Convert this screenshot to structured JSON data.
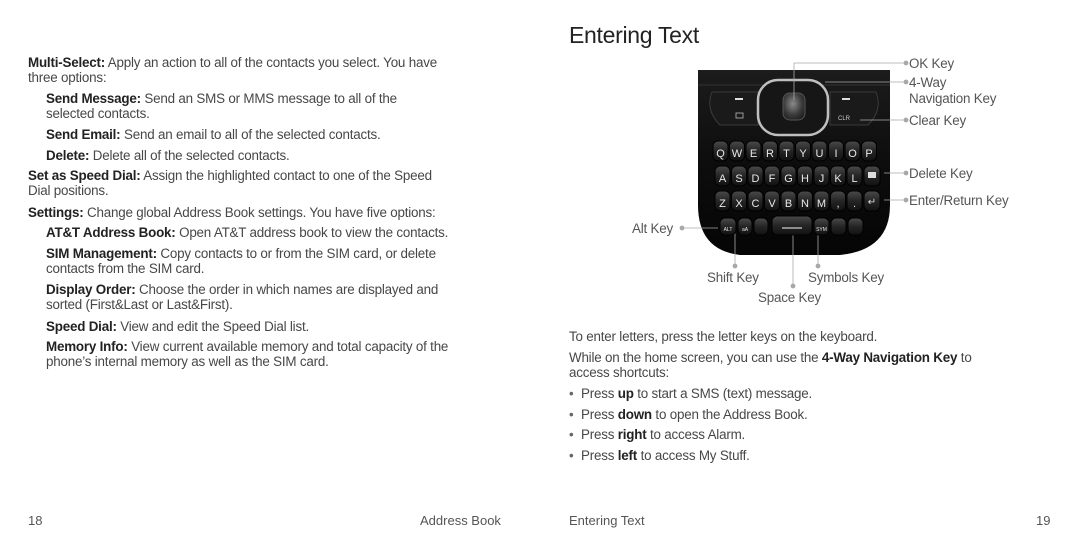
{
  "left_page": {
    "page_number": "18",
    "section_title": "Address Book",
    "entries": [
      {
        "label": "Multi-Select:",
        "text": " Apply an action to all of the contacts you select. You have",
        "text2": "three options:",
        "level": 0
      },
      {
        "label": "Send Message:",
        "text": " Send an SMS or MMS message to all of the",
        "text2": "selected contacts.",
        "level": 1
      },
      {
        "label": "Send Email:",
        "text": " Send an email to all of the selected contacts.",
        "text2": "",
        "level": 1
      },
      {
        "label": "Delete:",
        "text": " Delete all of the selected contacts.",
        "text2": "",
        "level": 1
      },
      {
        "label": "Set as Speed Dial:",
        "text": " Assign the highlighted contact to one of the Speed",
        "text2": "Dial positions.",
        "level": 0
      },
      {
        "label": "Settings:",
        "text": " Change global Address Book settings. You have five options:",
        "text2": "",
        "level": 0
      },
      {
        "label": "AT&T Address Book:",
        "text": " Open AT&T address book to view the contacts.",
        "text2": "",
        "level": 1
      },
      {
        "label": "SIM Management:",
        "text": " Copy contacts to or from the SIM card, or delete",
        "text2": "contacts from the SIM card.",
        "level": 1
      },
      {
        "label": "Display Order:",
        "text": " Choose the order in which names are displayed and",
        "text2": "sorted (First&Last or Last&First).",
        "level": 1
      },
      {
        "label": "Speed Dial:",
        "text": " View and edit the Speed Dial list.",
        "text2": "",
        "level": 1
      },
      {
        "label": "Memory Info:",
        "text": " View current available memory and total capacity of the",
        "text2": "phone’s internal memory as well as the SIM card.",
        "level": 1
      }
    ]
  },
  "right_page": {
    "page_number": "19",
    "section_title": "Entering Text",
    "heading": "Entering Text",
    "callouts": {
      "ok_key": "OK Key",
      "nav_key_line1": "4-Way",
      "nav_key_line2": "Navigation Key",
      "clear_key": "Clear Key",
      "delete_key": "Delete Key",
      "enter_key": "Enter/Return Key",
      "alt_key": "Alt Key",
      "shift_key": "Shift Key",
      "symbols_key": "Symbols Key",
      "space_key": "Space Key"
    },
    "keyboard": {
      "row1": [
        "Q",
        "W",
        "E",
        "R",
        "T",
        "Y",
        "U",
        "I",
        "O",
        "P"
      ],
      "row2": [
        "A",
        "S",
        "D",
        "F",
        "G",
        "H",
        "J",
        "K",
        "L"
      ],
      "row3": [
        "Z",
        "X",
        "C",
        "V",
        "B",
        "N",
        "M",
        ",",
        "."
      ],
      "clr_label": "CLR",
      "alt_label": "ALT",
      "shift_label": "aA",
      "sym_label": "SYM"
    },
    "intro": "To enter letters, press the letter keys on the keyboard.",
    "nav_para_pre": "While on the home screen, you can use the ",
    "nav_para_bold": "4-Way Navigation Key",
    "nav_para_post": " to",
    "nav_para_line2": "access shortcuts:",
    "bullets": [
      {
        "pre": "Press ",
        "bold": "up",
        "post": " to start a SMS (text) message."
      },
      {
        "pre": "Press ",
        "bold": "down",
        "post": " to open the Address Book."
      },
      {
        "pre": "Press ",
        "bold": "right",
        "post": " to access Alarm."
      },
      {
        "pre": "Press ",
        "bold": "left",
        "post": " to access My Stuff."
      }
    ],
    "bullet_glyph": "•"
  }
}
